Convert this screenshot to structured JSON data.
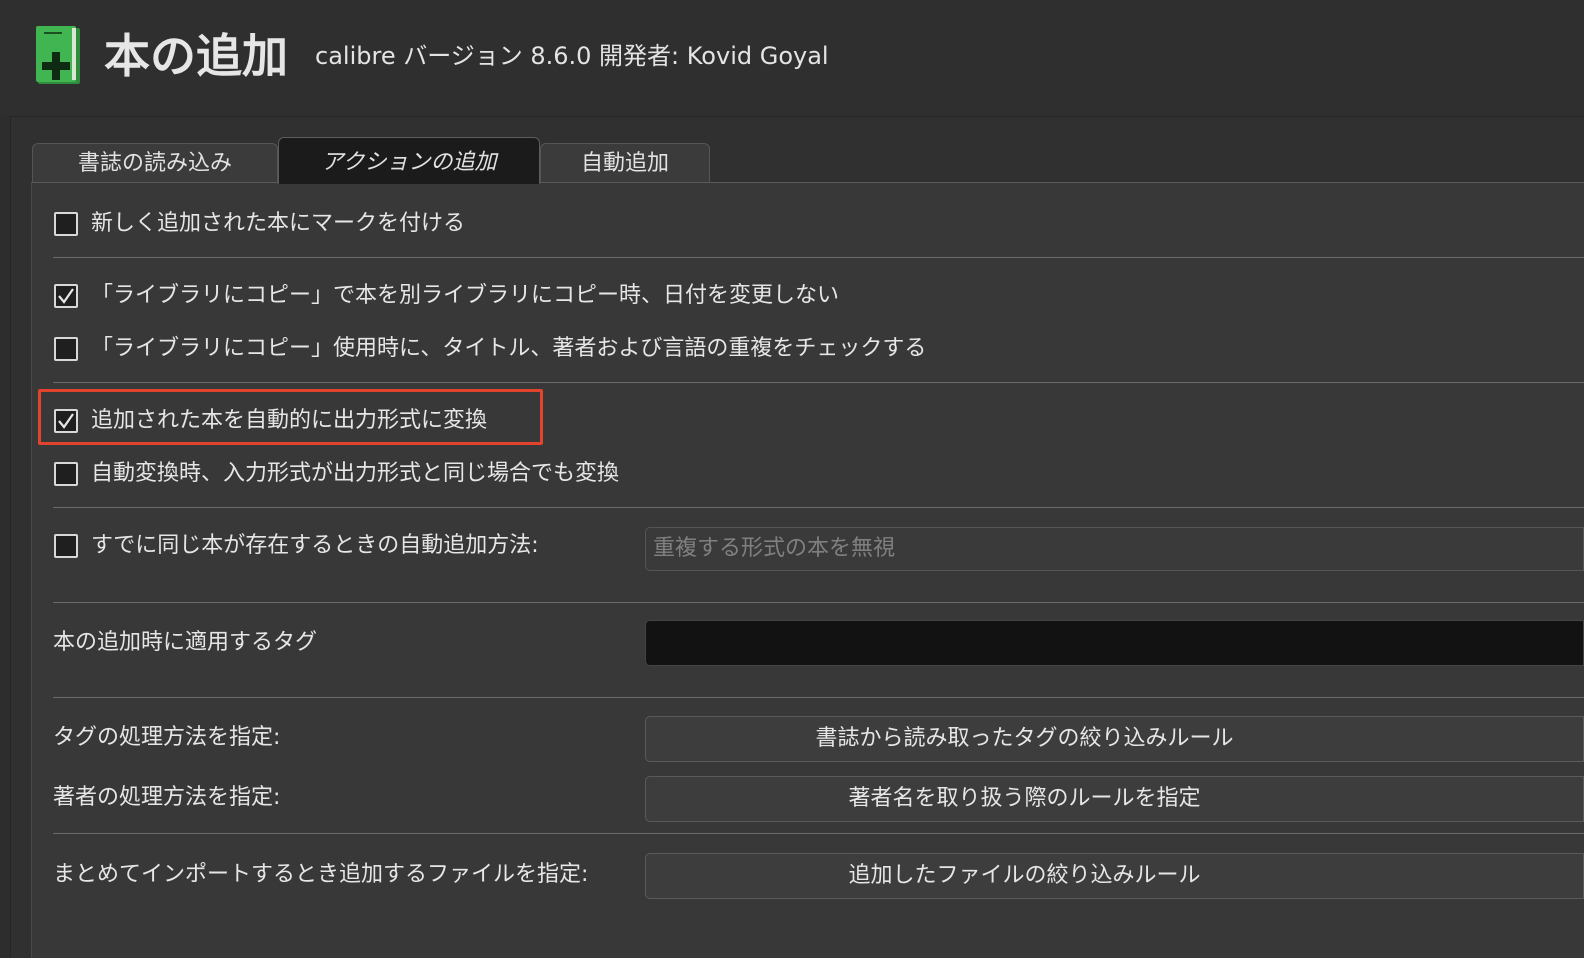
{
  "header": {
    "title": "本の追加",
    "subtitle": "calibre バージョン 8.6.0 開発者: Kovid Goyal",
    "icon": "green-book-plus-icon",
    "icon_color": "#3fb34f"
  },
  "tabs": [
    {
      "label": "書誌の読み込み",
      "active": false
    },
    {
      "label": "アクションの追加",
      "active": true
    },
    {
      "label": "自動追加",
      "active": false
    }
  ],
  "options": {
    "mark_new": {
      "label": "新しく追加された本にマークを付ける",
      "checked": false
    },
    "copy_keep_date": {
      "label": "「ライブラリにコピー」で本を別ライブラリにコピー時、日付を変更しない",
      "checked": true
    },
    "copy_check_duplicates": {
      "label": "「ライブラリにコピー」使用時に、タイトル、著者および言語の重複をチェックする",
      "checked": false
    },
    "auto_convert": {
      "label": "追加された本を自動的に出力形式に変換",
      "checked": true,
      "highlighted": true
    },
    "convert_same_format": {
      "label": "自動変換時、入力形式が出力形式と同じ場合でも変換",
      "checked": false
    },
    "auto_add_existing": {
      "label": "すでに同じ本が存在するときの自動追加方法:",
      "checked": false
    }
  },
  "duplicate_select": {
    "value": "重複する形式の本を無視",
    "disabled": true
  },
  "tags_on_add": {
    "label": "本の追加時に適用するタグ",
    "value": ""
  },
  "tag_rules": {
    "label": "タグの処理方法を指定:",
    "button": "書誌から読み取ったタグの絞り込みルール"
  },
  "author_rules": {
    "label": "著者の処理方法を指定:",
    "button": "著者名を取り扱う際のルールを指定"
  },
  "file_filter": {
    "label": "まとめてインポートするとき追加するファイルを指定:",
    "button": "追加したファイルの絞り込みルール"
  },
  "colors": {
    "highlight": "#e2432c",
    "background": "#383838"
  }
}
